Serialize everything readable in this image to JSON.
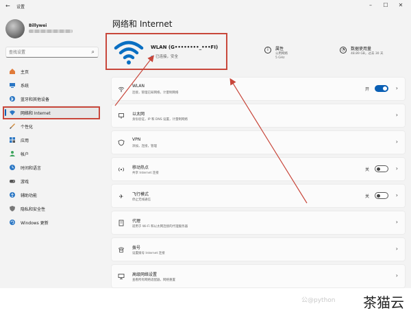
{
  "window": {
    "title": "设置",
    "back": "←",
    "controls": [
      "–",
      "☐",
      "✕"
    ]
  },
  "profile": {
    "name": "Billywei",
    "email": "•••••••••••••••••••"
  },
  "search": {
    "placeholder": "查找设置"
  },
  "sidebar": {
    "items": [
      {
        "label": "主页",
        "icon": "home-icon",
        "color": "#e07b39"
      },
      {
        "label": "系统",
        "icon": "monitor-icon",
        "color": "#2b77c4"
      },
      {
        "label": "蓝牙和其他设备",
        "icon": "bluetooth-icon",
        "color": "#2b77c4"
      },
      {
        "label": "网络和 Internet",
        "icon": "wifi-icon",
        "color": "#2b77c4",
        "active": true
      },
      {
        "label": "个性化",
        "icon": "brush-icon",
        "color": "#d08a3a"
      },
      {
        "label": "应用",
        "icon": "apps-icon",
        "color": "#2b77c4"
      },
      {
        "label": "帐户",
        "icon": "person-icon",
        "color": "#3aa35b"
      },
      {
        "label": "时间和语言",
        "icon": "globe-clock-icon",
        "color": "#2b77c4"
      },
      {
        "label": "游戏",
        "icon": "gamepad-icon",
        "color": "#555555"
      },
      {
        "label": "辅助功能",
        "icon": "accessibility-icon",
        "color": "#2b77c4"
      },
      {
        "label": "隐私和安全性",
        "icon": "shield-icon",
        "color": "#777777"
      },
      {
        "label": "Windows 更新",
        "icon": "update-icon",
        "color": "#2b77c4"
      }
    ]
  },
  "main": {
    "title": "网络和 Internet",
    "hero": {
      "name": "WLAN (G••••••••_•••FI)",
      "status": "已连接，安全"
    },
    "properties": {
      "title": "属性",
      "line1": "公用网络",
      "line2": "5 GHz"
    },
    "data_usage": {
      "title": "数据使用量",
      "line1": "48.89 GB，过去 30 天"
    },
    "rows": [
      {
        "title": "WLAN",
        "sub": "连接，管理已知网络，计量制网络",
        "icon": "wifi-icon",
        "toggle": "on",
        "toggle_label": "开"
      },
      {
        "title": "以太网",
        "sub": "身份验证，IP 和 DNS 设置，计量制网络",
        "icon": "ethernet-icon"
      },
      {
        "title": "VPN",
        "sub": "添加，连接，管理",
        "icon": "vpn-shield-icon"
      },
      {
        "title": "移动热点",
        "sub": "共享 Internet 连接",
        "icon": "hotspot-icon",
        "toggle": "off",
        "toggle_label": "关"
      },
      {
        "title": "飞行模式",
        "sub": "停止无线通信",
        "icon": "airplane-icon",
        "toggle": "off",
        "toggle_label": "关"
      },
      {
        "title": "代理",
        "sub": "适用于 Wi-Fi 和以太网连接的代理服务器",
        "icon": "proxy-server-icon"
      },
      {
        "title": "拨号",
        "sub": "设置拨号 Internet 连接",
        "icon": "dialup-icon"
      },
      {
        "title": "高级网络设置",
        "sub": "查看所有网络适配器，网络重置",
        "icon": "advanced-network-icon"
      }
    ]
  },
  "footer": {
    "watermark": "公@python",
    "brand": "茶猫云"
  },
  "colors": {
    "accent": "#0a5fb4",
    "highlight": "#c8463a"
  }
}
